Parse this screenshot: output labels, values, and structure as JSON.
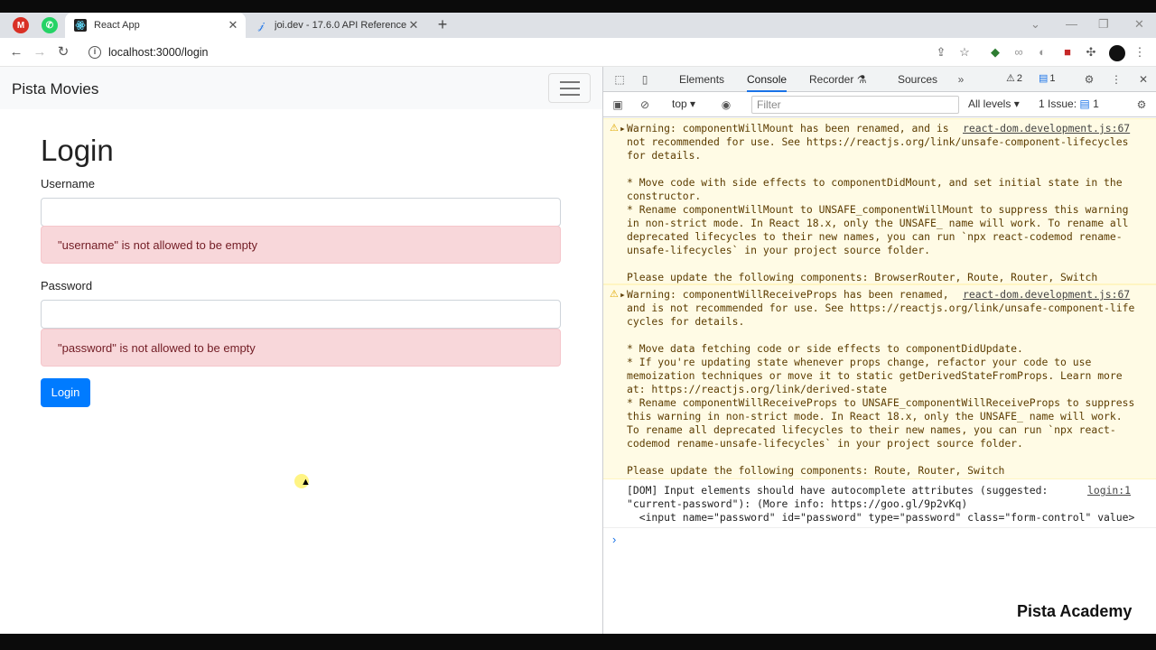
{
  "browser": {
    "tabs": [
      {
        "title": "React App",
        "active": true
      },
      {
        "title": "joi.dev - 17.6.0 API Reference",
        "active": false
      }
    ],
    "url": "localhost:3000/login"
  },
  "page": {
    "brand": "Pista Movies",
    "heading": "Login",
    "username_label": "Username",
    "username_value": "",
    "username_error": "\"username\" is not allowed to be empty",
    "password_label": "Password",
    "password_value": "",
    "password_error": "\"password\" is not allowed to be empty",
    "login_button": "Login"
  },
  "devtools": {
    "tabs": [
      "Elements",
      "Console",
      "Recorder",
      "Sources"
    ],
    "active_tab": "Console",
    "warnings_count": "2",
    "messages_count": "1",
    "context": "top",
    "filter_placeholder": "Filter",
    "levels": "All levels",
    "issues_label": "1 Issue:",
    "issues_count": "1",
    "messages": [
      {
        "lines": "Warning: componentWillMount has been renamed, and is\nnot recommended for use. See https://reactjs.org/link/unsafe-component-lifecycles\nfor details.\n\n* Move code with side effects to componentDidMount, and set initial state in the\nconstructor.\n* Rename componentWillMount to UNSAFE_componentWillMount to suppress this warning\nin non-strict mode. In React 18.x, only the UNSAFE_ name will work. To rename all\ndeprecated lifecycles to their new names, you can run `npx react-codemod rename-\nunsafe-lifecycles` in your project source folder.\n\nPlease update the following components: BrowserRouter, Route, Router, Switch",
        "source": "react-dom.development.js:67"
      },
      {
        "lines": "Warning: componentWillReceiveProps has been renamed,\nand is not recommended for use. See https://reactjs.org/link/unsafe-component-life\ncycles for details.\n\n* Move data fetching code or side effects to componentDidUpdate.\n* If you're updating state whenever props change, refactor your code to use\nmemoization techniques or move it to static getDerivedStateFromProps. Learn more\nat: https://reactjs.org/link/derived-state\n* Rename componentWillReceiveProps to UNSAFE_componentWillReceiveProps to suppress\nthis warning in non-strict mode. In React 18.x, only the UNSAFE_ name will work.\nTo rename all deprecated lifecycles to their new names, you can run `npx react-\ncodemod rename-unsafe-lifecycles` in your project source folder.\n\nPlease update the following components: Route, Router, Switch",
        "source": "react-dom.development.js:67"
      },
      {
        "lines": "[DOM] Input elements should have autocomplete attributes (suggested:\n\"current-password\"): (More info: https://goo.gl/9p2vKq)\n  <input name=\"password\" id=\"password\" type=\"password\" class=\"form-control\" value>",
        "source": "login:1"
      }
    ]
  },
  "watermark": "Pista Academy"
}
